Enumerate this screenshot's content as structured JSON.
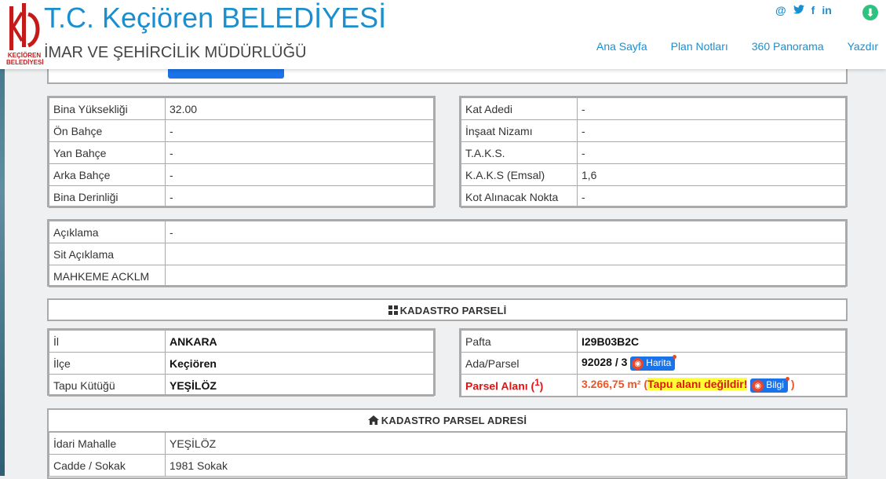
{
  "header": {
    "title": "T.C. Keçiören BELEDİYESİ",
    "subtitle": "İMAR VE ŞEHİRCİLİK MÜDÜRLÜĞÜ",
    "logo_text": "KEÇİÖREN BELEDİYESİ",
    "nav": [
      "Ana Sayfa",
      "Plan Notları",
      "360 Panorama",
      "Yazdır"
    ],
    "social": {
      "at": "@",
      "twitter": "🐦",
      "facebook": "f",
      "linkedin": "in"
    },
    "accent_color": "#1a8fd0"
  },
  "building": {
    "left": [
      {
        "label": "Bina Yüksekliği",
        "value": "32.00"
      },
      {
        "label": "Ön Bahçe",
        "value": "-"
      },
      {
        "label": "Yan Bahçe",
        "value": "-"
      },
      {
        "label": "Arka Bahçe",
        "value": "-"
      },
      {
        "label": "Bina Derinliği",
        "value": "-"
      }
    ],
    "right": [
      {
        "label": "Kat Adedi",
        "value": "-"
      },
      {
        "label": "İnşaat Nizamı",
        "value": "-"
      },
      {
        "label": "T.A.K.S.",
        "value": "-"
      },
      {
        "label": "K.A.K.S (Emsal)",
        "value": "1,6"
      },
      {
        "label": "Kot Alınacak Nokta",
        "value": "-"
      }
    ]
  },
  "notes": [
    {
      "label": "Açıklama",
      "value": "-"
    },
    {
      "label": "Sit Açıklama",
      "value": ""
    },
    {
      "label": "MAHKEME ACKLM",
      "value": ""
    }
  ],
  "kadastro": {
    "title": "KADASTRO PARSELİ",
    "left": [
      {
        "label": "İl",
        "value": "ANKARA"
      },
      {
        "label": "İlçe",
        "value": "Keçiören"
      },
      {
        "label": "Tapu Kütüğü",
        "value": "YEŞİLÖZ"
      }
    ],
    "pafta_label": "Pafta",
    "pafta_value": "I29B03B2C",
    "ada_label": "Ada/Parsel",
    "ada_value": "92028 / 3",
    "harita_label": "Harita",
    "alan_label": "Parsel Alanı (",
    "alan_sup": "1",
    "alan_label_end": ")",
    "alan_value": "3.266,75 m²",
    "alan_open": " (",
    "alan_warning": "Tapu alanı değildir!",
    "bilgi_label": "Bilgi",
    "alan_close": " )"
  },
  "adres": {
    "title": "KADASTRO PARSEL ADRESİ",
    "rows": [
      {
        "label": "İdari Mahalle",
        "value": "YEŞİLÖZ"
      },
      {
        "label": "Cadde / Sokak",
        "value": "1981 Sokak"
      }
    ]
  }
}
